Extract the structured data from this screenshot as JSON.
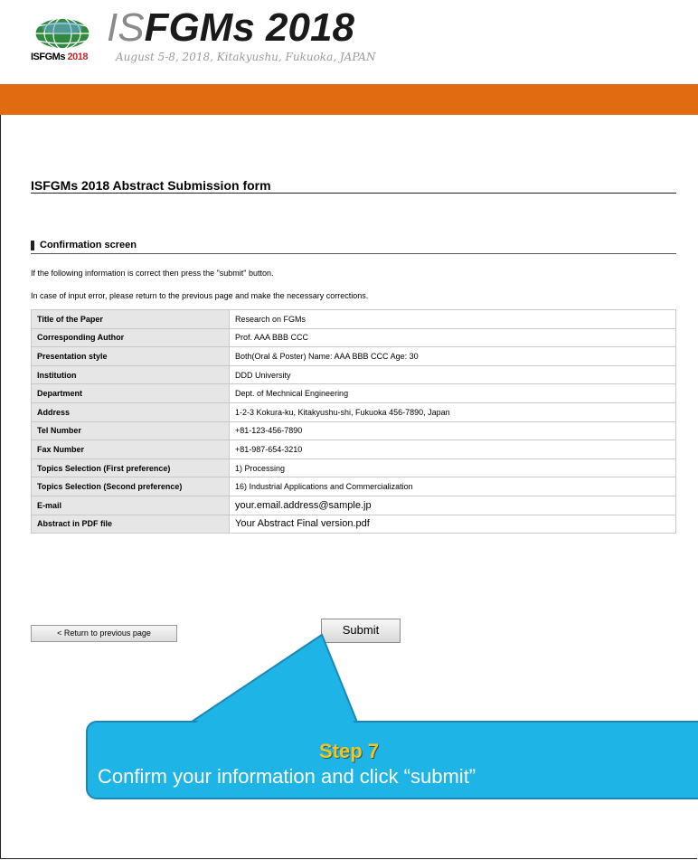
{
  "header": {
    "brand_prefix": "IS",
    "brand_main": "FGMs 2018",
    "date_location": "August 5-8, 2018, Kitakyushu, Fukuoka, JAPAN",
    "logo_caption_a": "ISFGMs",
    "logo_caption_b": "2018"
  },
  "form": {
    "title": "ISFGMs 2018 Abstract Submission form",
    "section_title": "Confirmation screen",
    "instruction_1": "If the following information is correct then press the \"submit\" button.",
    "instruction_2": "In case of input error, please return to the previous page and make the necessary corrections.",
    "rows": [
      {
        "label": "Title of the Paper",
        "value": "Research on FGMs"
      },
      {
        "label": "Corresponding Author",
        "value": "Prof. AAA BBB CCC"
      },
      {
        "label": "Presentation style",
        "value": "Both(Oral & Poster)  Name: AAA BBB CCC Age: 30"
      },
      {
        "label": "Institution",
        "value": "DDD University"
      },
      {
        "label": "Department",
        "value": "Dept. of Mechnical Engineering"
      },
      {
        "label": "Address",
        "value": "1-2-3 Kokura-ku, Kitakyushu-shi, Fukuoka 456-7890, Japan"
      },
      {
        "label": "Tel Number",
        "value": "+81-123-456-7890"
      },
      {
        "label": "Fax Number",
        "value": "+81-987-654-3210"
      },
      {
        "label": "Topics Selection (First preference)",
        "value": "1) Processing"
      },
      {
        "label": "Topics Selection (Second preference)",
        "value": "16) Industrial Applications and Commercialization"
      },
      {
        "label": "E-mail",
        "value": "your.email.address@sample.jp"
      },
      {
        "label": "Abstract in PDF file",
        "value": "Your Abstract Final version.pdf"
      }
    ],
    "back_label": "< Return to previous page",
    "submit_label": "Submit"
  },
  "callout": {
    "step": "Step 7",
    "text": "Confirm your information and click “submit”"
  },
  "colors": {
    "orange_band": "#e06b10",
    "callout_bg": "#1fb4e6",
    "step_text": "#f3c51e"
  }
}
